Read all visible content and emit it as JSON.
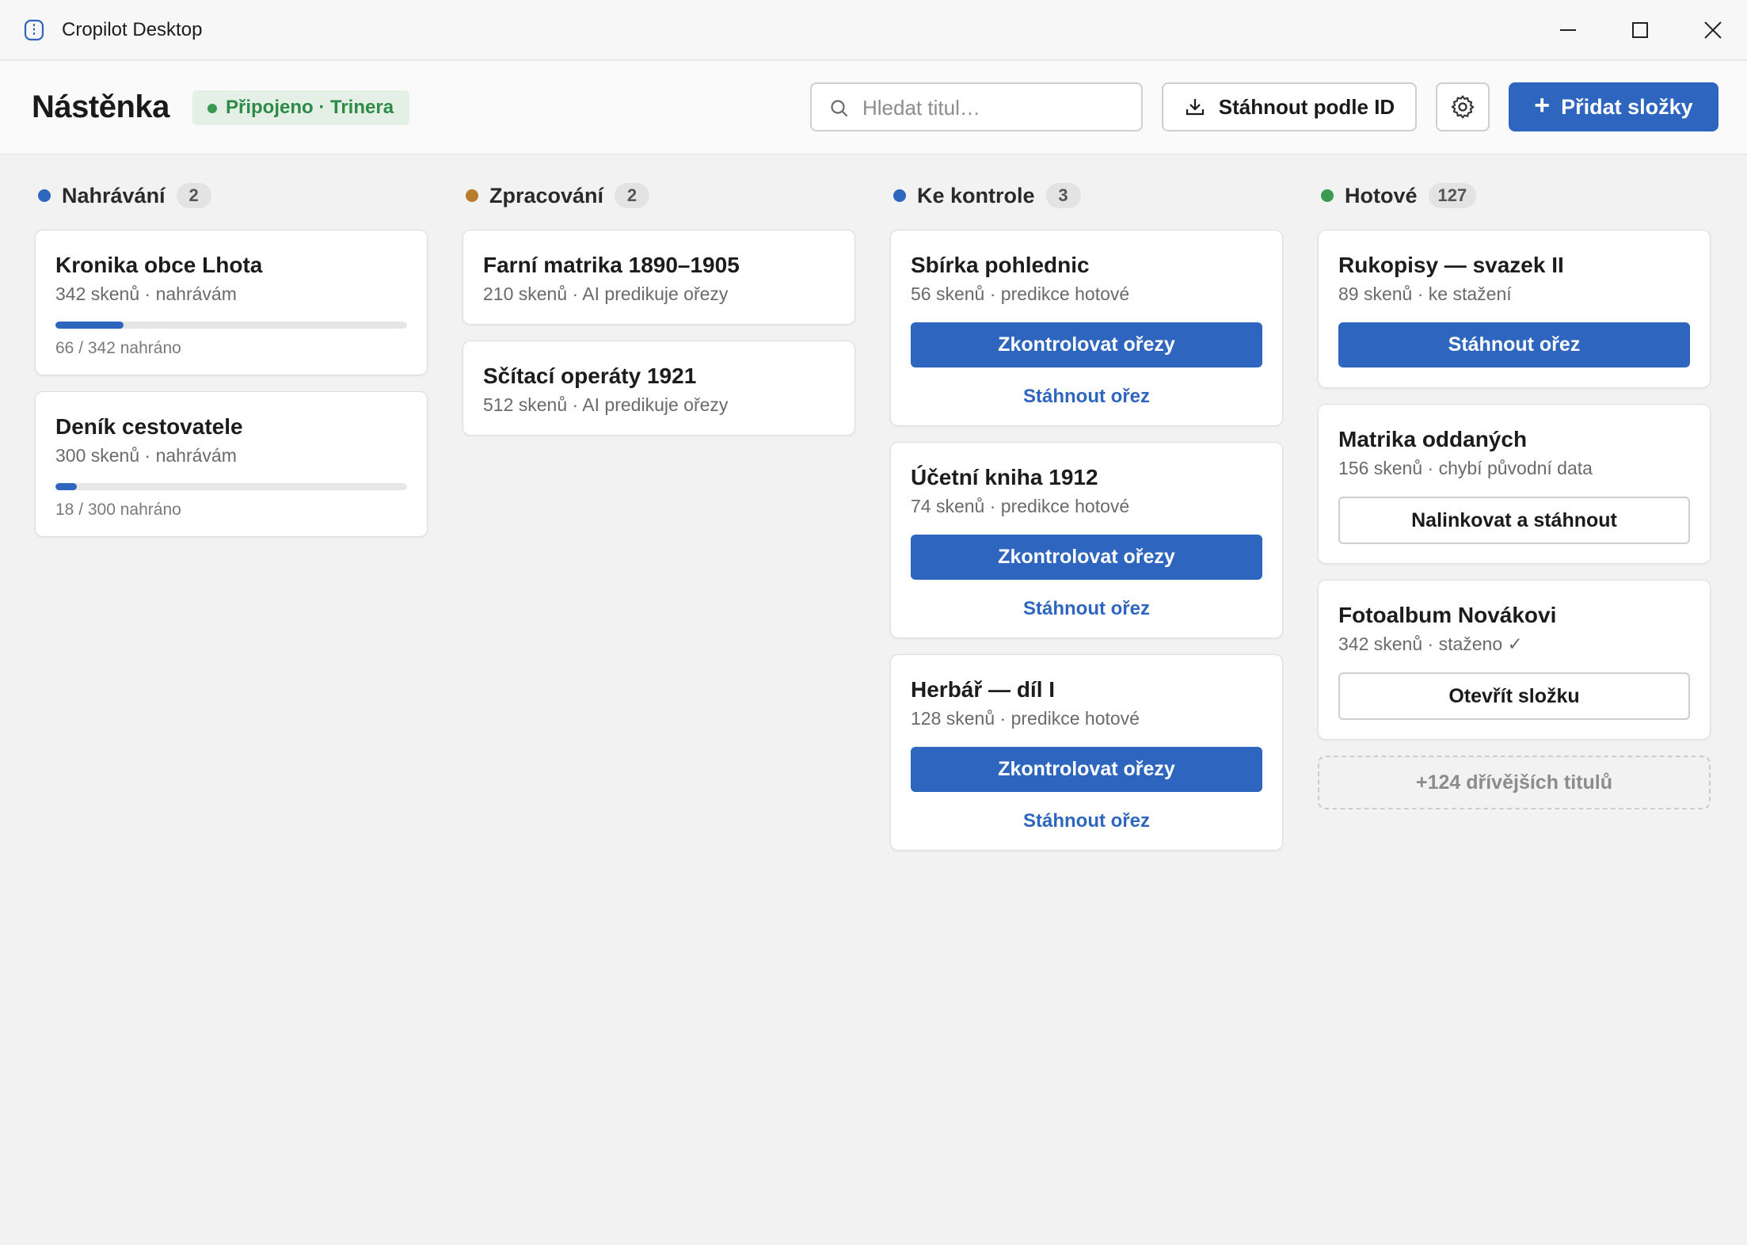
{
  "window": {
    "title": "Cropilot Desktop"
  },
  "header": {
    "title": "Nástěnka",
    "status": "Připojeno · Trinera",
    "search_placeholder": "Hledat titul…",
    "download_by_id": "Stáhnout podle ID",
    "add_folders": "Přidat složky"
  },
  "colors": {
    "accent": "#2e66bf",
    "connected": "#3a9a52",
    "processing": "#b87d2b",
    "done": "#3a9a52"
  },
  "columns": [
    {
      "title": "Nahrávání",
      "count": "2",
      "cards": [
        {
          "title": "Kronika obce Lhota",
          "meta": "342 skenů · nahrávám",
          "progress": 0.193,
          "progress_text": "66 / 342 nahráno"
        },
        {
          "title": "Deník cestovatele",
          "meta": "300 skenů · nahrávám",
          "progress": 0.06,
          "progress_text": "18 / 300 nahráno"
        }
      ]
    },
    {
      "title": "Zpracování",
      "count": "2",
      "cards": [
        {
          "title": "Farní matrika 1890–1905",
          "meta": "210 skenů · AI predikuje ořezy"
        },
        {
          "title": "Sčítací operáty 1921",
          "meta": "512 skenů · AI predikuje ořezy"
        }
      ]
    },
    {
      "title": "Ke kontrole",
      "count": "3",
      "cards": [
        {
          "title": "Sbírka pohlednic",
          "meta": "56 skenů · predikce hotové",
          "primary": "Zkontrolovat ořezy",
          "link": "Stáhnout ořez"
        },
        {
          "title": "Účetní kniha 1912",
          "meta": "74 skenů · predikce hotové",
          "primary": "Zkontrolovat ořezy",
          "link": "Stáhnout ořez"
        },
        {
          "title": "Herbář — díl I",
          "meta": "128 skenů · predikce hotové",
          "primary": "Zkontrolovat ořezy",
          "link": "Stáhnout ořez"
        }
      ]
    },
    {
      "title": "Hotové",
      "count": "127",
      "cards": [
        {
          "title": "Rukopisy — svazek II",
          "meta": "89 skenů · ke stažení",
          "primary": "Stáhnout ořez"
        },
        {
          "title": "Matrika oddaných",
          "meta": "156 skenů · chybí původní data",
          "secondary": "Nalinkovat a stáhnout"
        },
        {
          "title": "Fotoalbum Novákovi",
          "meta": "342 skenů · staženo ✓",
          "secondary": "Otevřít složku"
        }
      ],
      "more": "+124 dřívějších titulů"
    }
  ]
}
